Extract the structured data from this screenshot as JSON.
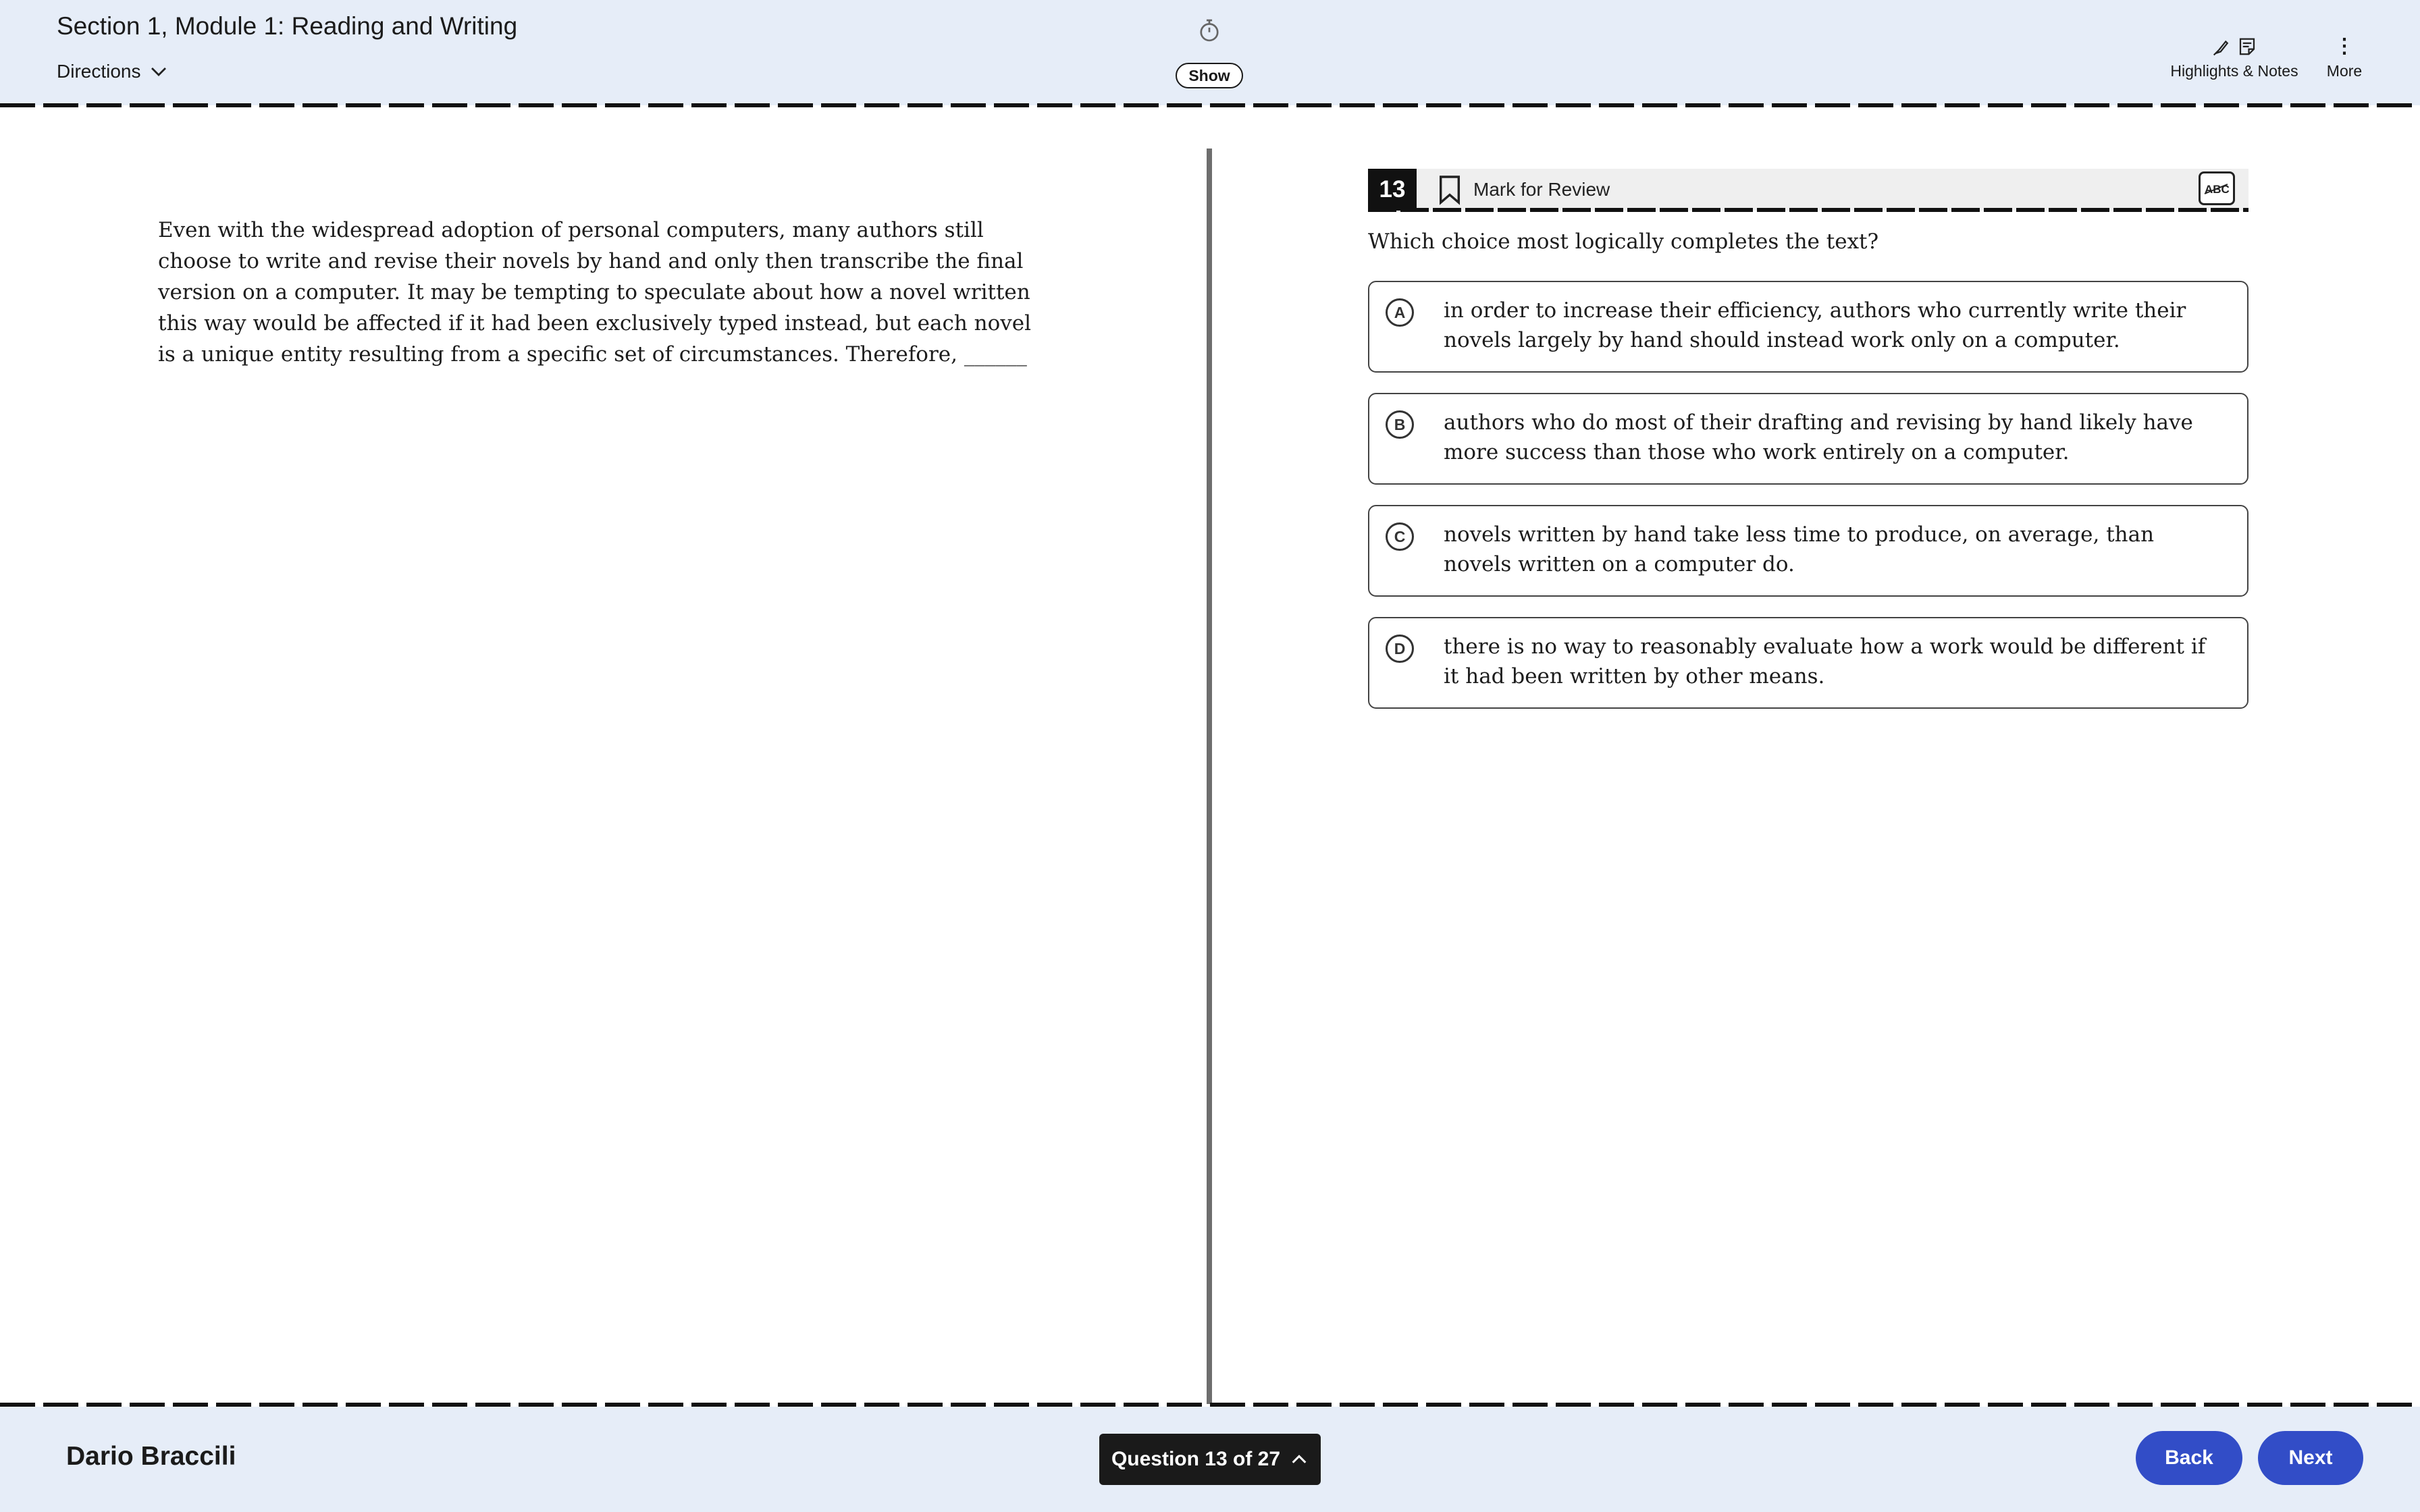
{
  "header": {
    "section_title": "Section 1, Module 1: Reading and Writing",
    "directions_label": "Directions",
    "timer_toggle_label": "Show",
    "highlights_notes_label": "Highlights & Notes",
    "more_label": "More"
  },
  "passage": {
    "text": "Even with the widespread adoption of personal computers, many authors still choose to write and revise their novels by hand and only then transcribe the final version on a computer. It may be tempting to speculate about how a novel written this way would be affected if it had been exclusively typed instead, but each novel is a unique entity resulting from a specific set of circumstances. Therefore, ______"
  },
  "question": {
    "number": "13",
    "mark_for_review_label": "Mark for Review",
    "prompt": "Which choice most logically completes the text?",
    "choices": [
      {
        "letter": "A",
        "text": "in order to increase their efficiency, authors who currently write their novels largely by hand should instead work only on a computer."
      },
      {
        "letter": "B",
        "text": "authors who do most of their drafting and revising by hand likely have more success than those who work entirely on a computer."
      },
      {
        "letter": "C",
        "text": "novels written by hand take less time to produce, on average, than novels written on a computer do."
      },
      {
        "letter": "D",
        "text": "there is no way to reasonably evaluate how a work would be different if it had been written by other means."
      }
    ]
  },
  "footer": {
    "student_name": "Dario Braccili",
    "question_nav_label": "Question 13 of 27",
    "back_label": "Back",
    "next_label": "Next"
  },
  "colors": {
    "header_bg": "#e6edf8",
    "primary_button": "#324dc7",
    "question_number_bg": "#111111"
  },
  "icons": [
    "chevron-down-icon",
    "timer-icon",
    "highlighter-icon",
    "notes-icon",
    "more-vertical-icon",
    "bookmark-icon",
    "strikethrough-abc-icon",
    "chevron-up-icon"
  ]
}
